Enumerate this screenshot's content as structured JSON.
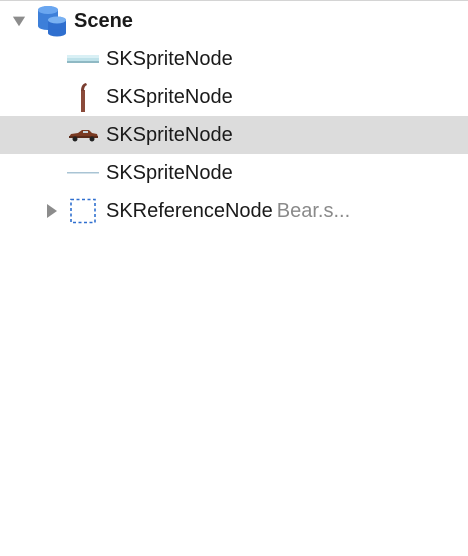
{
  "scene": {
    "label": "Scene",
    "icon": "scene-database-icon",
    "expanded": true
  },
  "nodes": [
    {
      "label": "SKSpriteNode",
      "icon": "ground-strip-thumbnail"
    },
    {
      "label": "SKSpriteNode",
      "icon": "pole-thumbnail"
    },
    {
      "label": "SKSpriteNode",
      "icon": "car-thumbnail",
      "selected": true
    },
    {
      "label": "SKSpriteNode",
      "icon": "thin-line-thumbnail"
    },
    {
      "label": "SKReferenceNode",
      "detail": "Bear.s...",
      "icon": "reference-node-dashed-icon",
      "expanded": false
    }
  ],
  "colors": {
    "selection": "#dcdcdc",
    "scene_icon": "#3d7fd9",
    "detail_text": "#8a8a8a"
  }
}
